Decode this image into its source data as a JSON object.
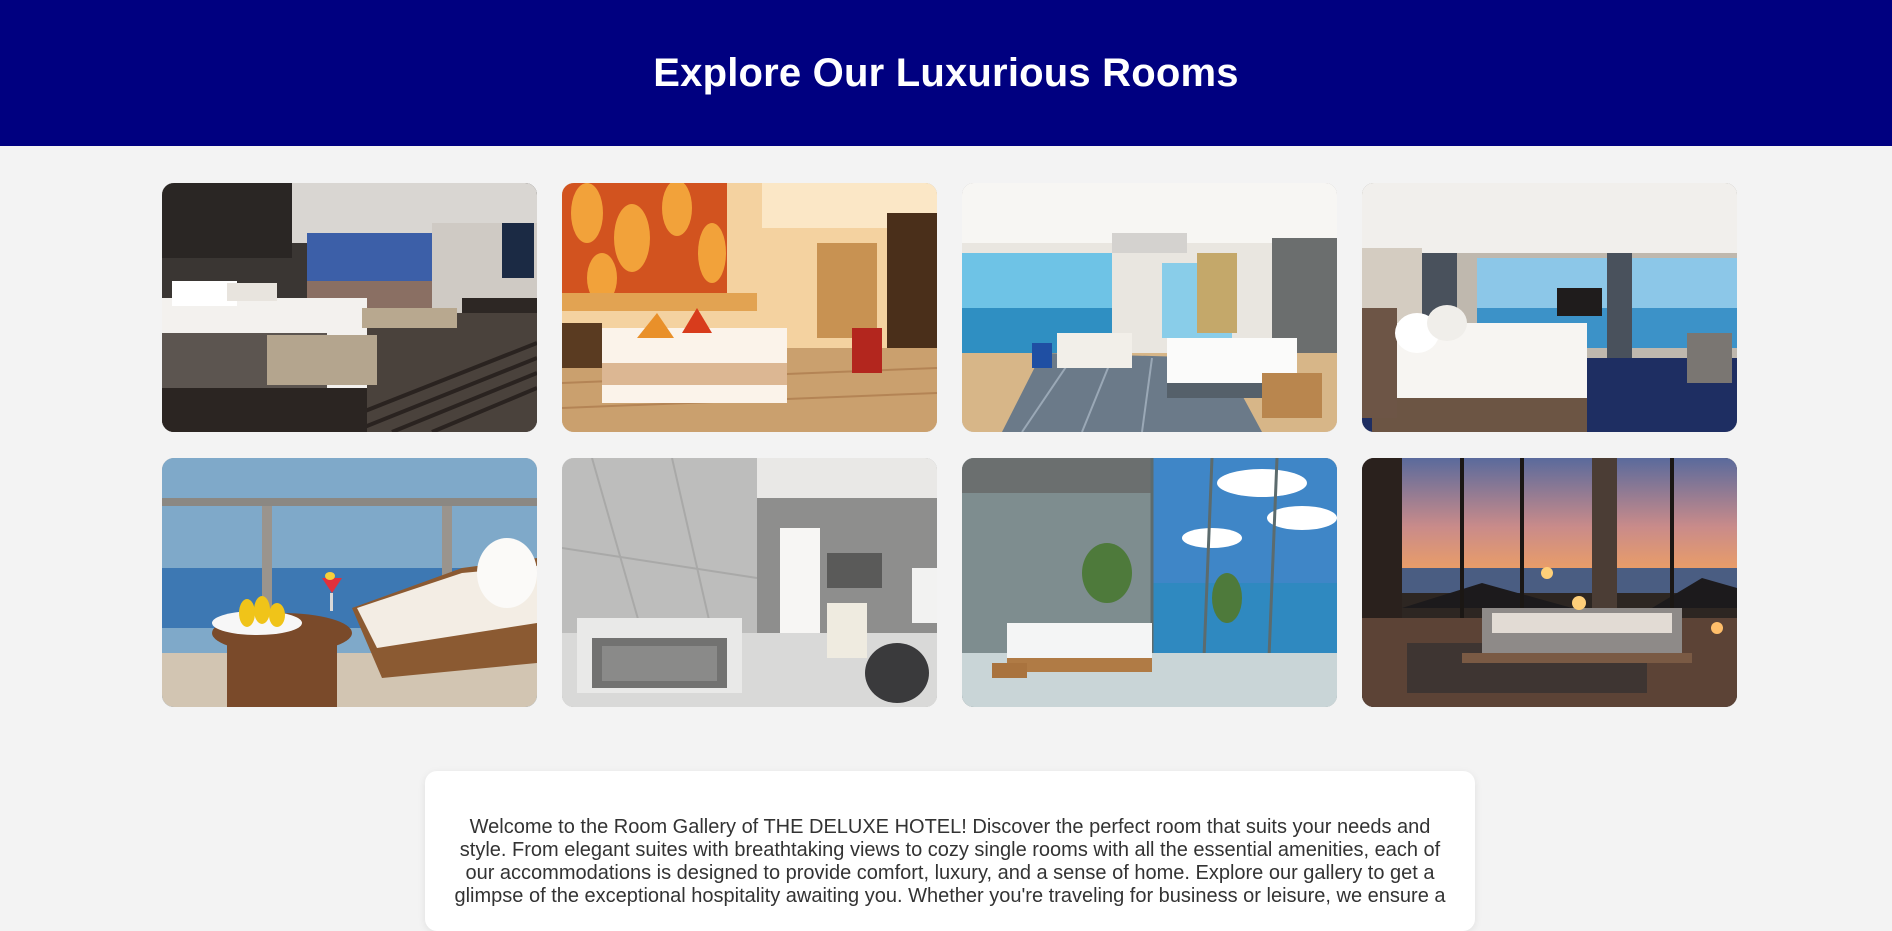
{
  "header": {
    "title": "Explore Our Luxurious Rooms",
    "background": "#000080"
  },
  "gallery": {
    "rooms": [
      {
        "scene": "city-view-bedroom"
      },
      {
        "scene": "orange-wall-bedroom"
      },
      {
        "scene": "ocean-view-suite"
      },
      {
        "scene": "panoramic-sea-bedroom"
      },
      {
        "scene": "balcony-fruit-lounge"
      },
      {
        "scene": "marble-bathroom"
      },
      {
        "scene": "glass-wall-ocean-bedroom"
      },
      {
        "scene": "sunset-villa-bedroom"
      }
    ]
  },
  "welcome": {
    "text": "Welcome to the Room Gallery of THE DELUXE HOTEL! Discover the perfect room that suits your needs and style. From elegant suites with breathtaking views to cozy single rooms with all the essential amenities, each of our accommodations is designed to provide comfort, luxury, and a sense of home. Explore our gallery to get a glimpse of the exceptional hospitality awaiting you. Whether you're traveling for business or leisure, we ensure a"
  }
}
